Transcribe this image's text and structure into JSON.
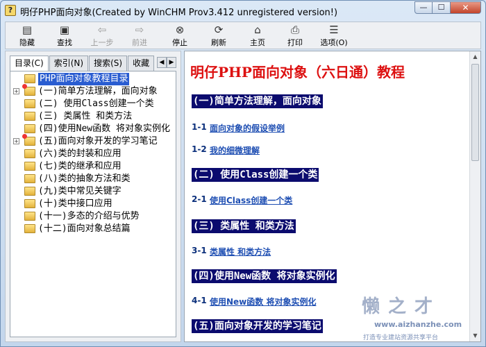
{
  "window": {
    "title": "明仔PHP面向对象(Created by WinCHM Prov3.412 unregistered version!)",
    "app_icon": "?",
    "controls": {
      "minimize": "—",
      "maximize": "☐",
      "close": "✕"
    }
  },
  "toolbar": {
    "buttons": [
      {
        "label": "隐藏",
        "icon": "hide-pane-icon",
        "glyph": "▤"
      },
      {
        "label": "查找",
        "icon": "locate-icon",
        "glyph": "▣"
      },
      {
        "label": "上一步",
        "icon": "back-arrow-icon",
        "glyph": "⇦",
        "disabled": true
      },
      {
        "label": "前进",
        "icon": "forward-arrow-icon",
        "glyph": "⇨",
        "disabled": true
      },
      {
        "label": "停止",
        "icon": "stop-icon",
        "glyph": "⊗"
      },
      {
        "label": "刷新",
        "icon": "refresh-icon",
        "glyph": "⟳"
      },
      {
        "label": "主页",
        "icon": "home-icon",
        "glyph": "⌂"
      },
      {
        "label": "打印",
        "icon": "printer-icon",
        "glyph": "⎙"
      },
      {
        "label": "选项(O)",
        "icon": "options-icon",
        "glyph": "☰"
      }
    ]
  },
  "nav": {
    "tabs": [
      {
        "label": "目录(C)",
        "active": true
      },
      {
        "label": "索引(N)"
      },
      {
        "label": "搜索(S)"
      },
      {
        "label": "收藏"
      }
    ],
    "tab_scroll": {
      "left": "◀",
      "right": "▶"
    },
    "tree": [
      {
        "label": "PHP面向对象教程目录",
        "selected": true,
        "expander": ""
      },
      {
        "label": "(一)简单方法理解，面向对象",
        "expander": "+",
        "new": true
      },
      {
        "label": "(二) 使用Class创建一个类",
        "expander": ""
      },
      {
        "label": "(三) 类属性 和类方法",
        "expander": ""
      },
      {
        "label": "(四)使用New函数 将对象实例化",
        "expander": ""
      },
      {
        "label": "(五)面向对象开发的学习笔记",
        "expander": "+",
        "new": true
      },
      {
        "label": "(六)类的封装和应用",
        "expander": ""
      },
      {
        "label": "(七)类的继承和应用",
        "expander": ""
      },
      {
        "label": "(八)类的抽象方法和类",
        "expander": ""
      },
      {
        "label": "(九)类中常见关键字",
        "expander": ""
      },
      {
        "label": "(十)类中接口应用",
        "expander": ""
      },
      {
        "label": "(十一)多态的介绍与优势",
        "expander": ""
      },
      {
        "label": "(十二)面向对象总结篇",
        "expander": ""
      }
    ]
  },
  "content": {
    "title": "明仔PHP面向对象（六日通）教程",
    "chapters": [
      {
        "heading": "(一)简单方法理解，面向对象",
        "sections": [
          {
            "num": "1-1",
            "link": "面向对象的假设举例"
          },
          {
            "num": "1-2",
            "link": "我的细微理解"
          }
        ]
      },
      {
        "heading": "(二) 使用Class创建一个类",
        "sections": [
          {
            "num": "2-1",
            "link": "使用Class创建一个类"
          }
        ]
      },
      {
        "heading": "(三) 类属性 和类方法",
        "sections": [
          {
            "num": "3-1",
            "link": "类属性 和类方法"
          }
        ]
      },
      {
        "heading": "(四)使用New函数 将对象实例化",
        "sections": [
          {
            "num": "4-1",
            "link": "使用New函数 将对象实例化"
          }
        ]
      },
      {
        "heading": "(五)面向对象开发的学习笔记",
        "sections": []
      }
    ],
    "scrollbar": {
      "up": "▲",
      "down": "▼"
    }
  },
  "watermark": {
    "logo": "懒之才",
    "url": "www.aizhanzhe.com",
    "slogan": "打造专业建站资源共享平台"
  }
}
